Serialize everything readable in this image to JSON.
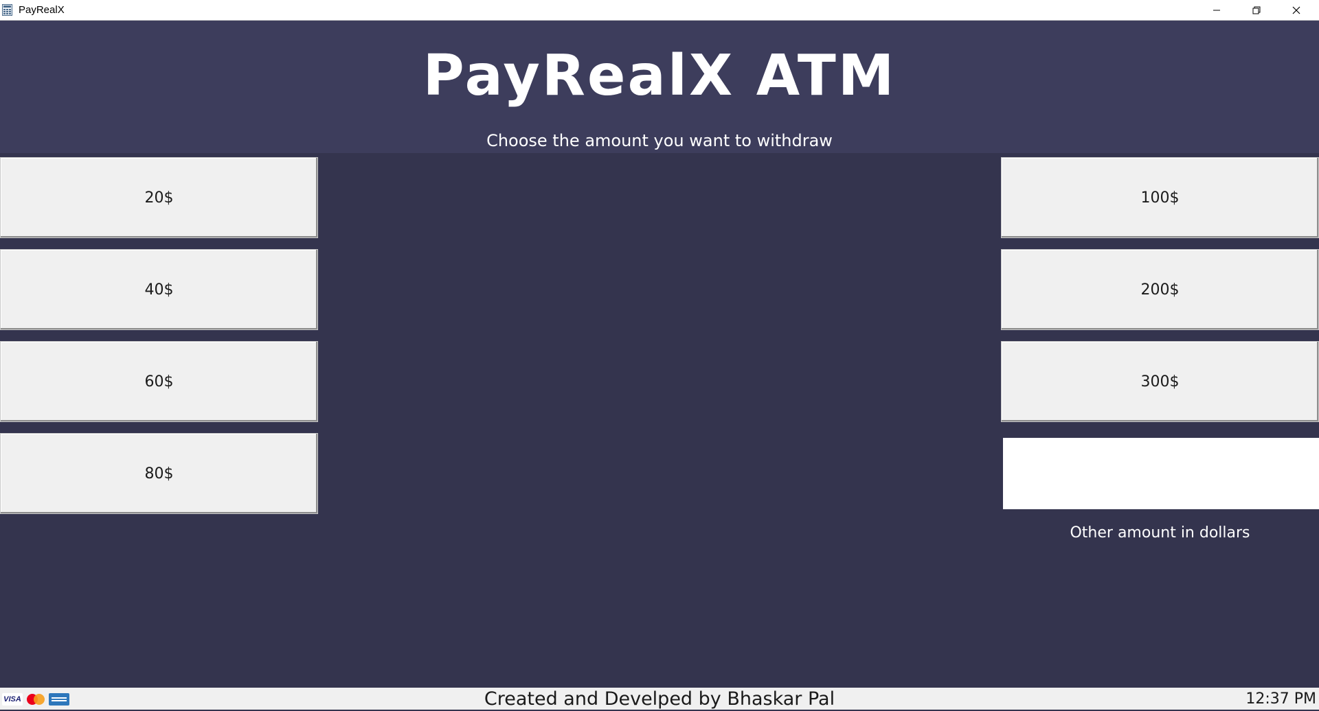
{
  "window": {
    "title": "PayRealX",
    "controls": [
      "minimize-icon",
      "restore-icon",
      "close-icon"
    ]
  },
  "header": {
    "title": "PayRealX ATM",
    "subtitle": "Choose the amount you want to withdraw"
  },
  "amounts": {
    "left": [
      "20$",
      "40$",
      "60$",
      "80$"
    ],
    "right": [
      "100$",
      "200$",
      "300$"
    ]
  },
  "other_amount": {
    "value": "",
    "label": "Other amount in dollars"
  },
  "footer": {
    "cards": [
      "VISA",
      "mastercard-icon",
      "amex-icon"
    ],
    "credits": "Created and Develped by Bhaskar Pal",
    "time": "12:37 PM"
  },
  "colors": {
    "background": "#34344e",
    "header": "#3d3d5c",
    "button": "#f0f0f0",
    "text_light": "#ffffff"
  }
}
